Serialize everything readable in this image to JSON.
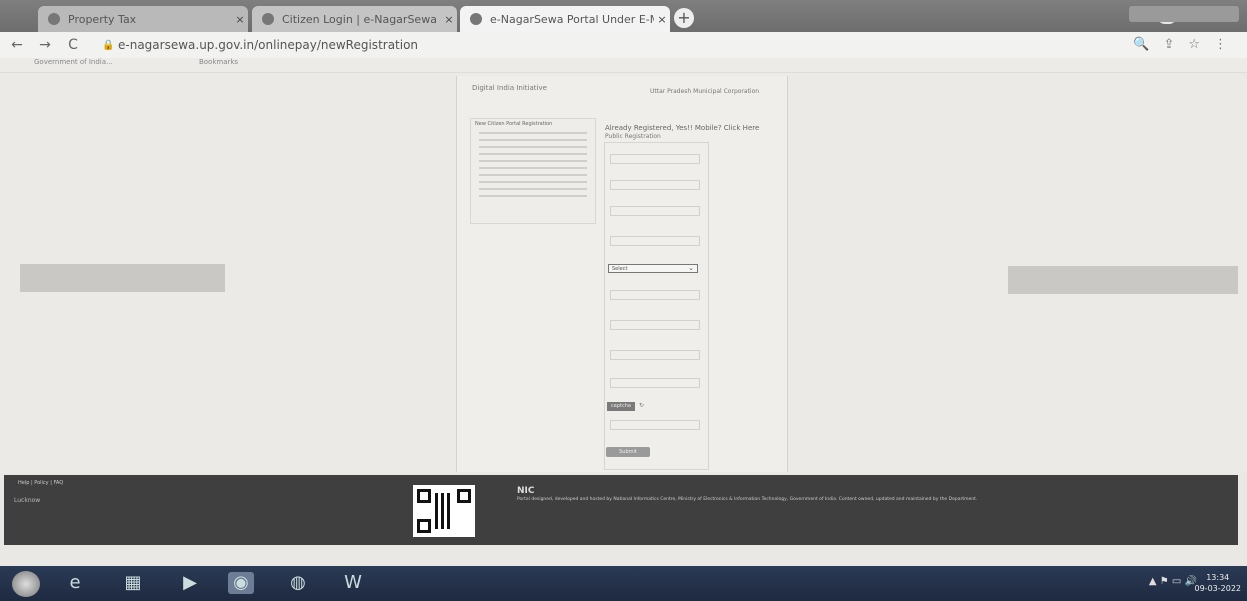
{
  "browser": {
    "tabs": [
      {
        "label": "Property Tax",
        "close": "×"
      },
      {
        "label": "Citizen Login | e-NagarSewa Portal",
        "close": "×"
      },
      {
        "label": "e-NagarSewa Portal Under E-Municipality",
        "close": "×"
      }
    ],
    "new_tab": "+",
    "url": "e-nagarsewa.up.gov.in/onlinepay/newRegistration",
    "nav": {
      "back": "←",
      "forward": "→",
      "reload": "C"
    },
    "toolbar_icons": {
      "search": "🔍",
      "share": "⇪",
      "star": "☆",
      "menu": "⋮"
    },
    "bookmarks": [
      "Government of India...",
      "Bookmarks"
    ]
  },
  "page": {
    "header_left": "Digital India Initiative",
    "header_right": "Uttar Pradesh Municipal Corporation",
    "left_col_title": "New Citizen Portal Registration",
    "form_title": "Already Registered, Yes!! Mobile? Click Here",
    "form_subtitle": "Public Registration",
    "select_value": "Select",
    "select_chevron": "⌄",
    "captcha": "captcha",
    "refresh": "↻",
    "submit_label": "Submit"
  },
  "footer": {
    "links": "Help | Policy | FAQ",
    "location": "Lucknow",
    "nic_logo": "NIC",
    "nic_text": "Portal designed, developed and hosted by National Informatics Centre, Ministry of Electronics & Information Technology, Government of India. Content owned, updated and maintained by the Department."
  },
  "taskbar": {
    "icons": [
      "ie-icon",
      "folder-icon",
      "media-icon",
      "chrome-icon",
      "firefox-icon",
      "word-icon"
    ],
    "time": "13:34",
    "date": "09-03-2022"
  }
}
